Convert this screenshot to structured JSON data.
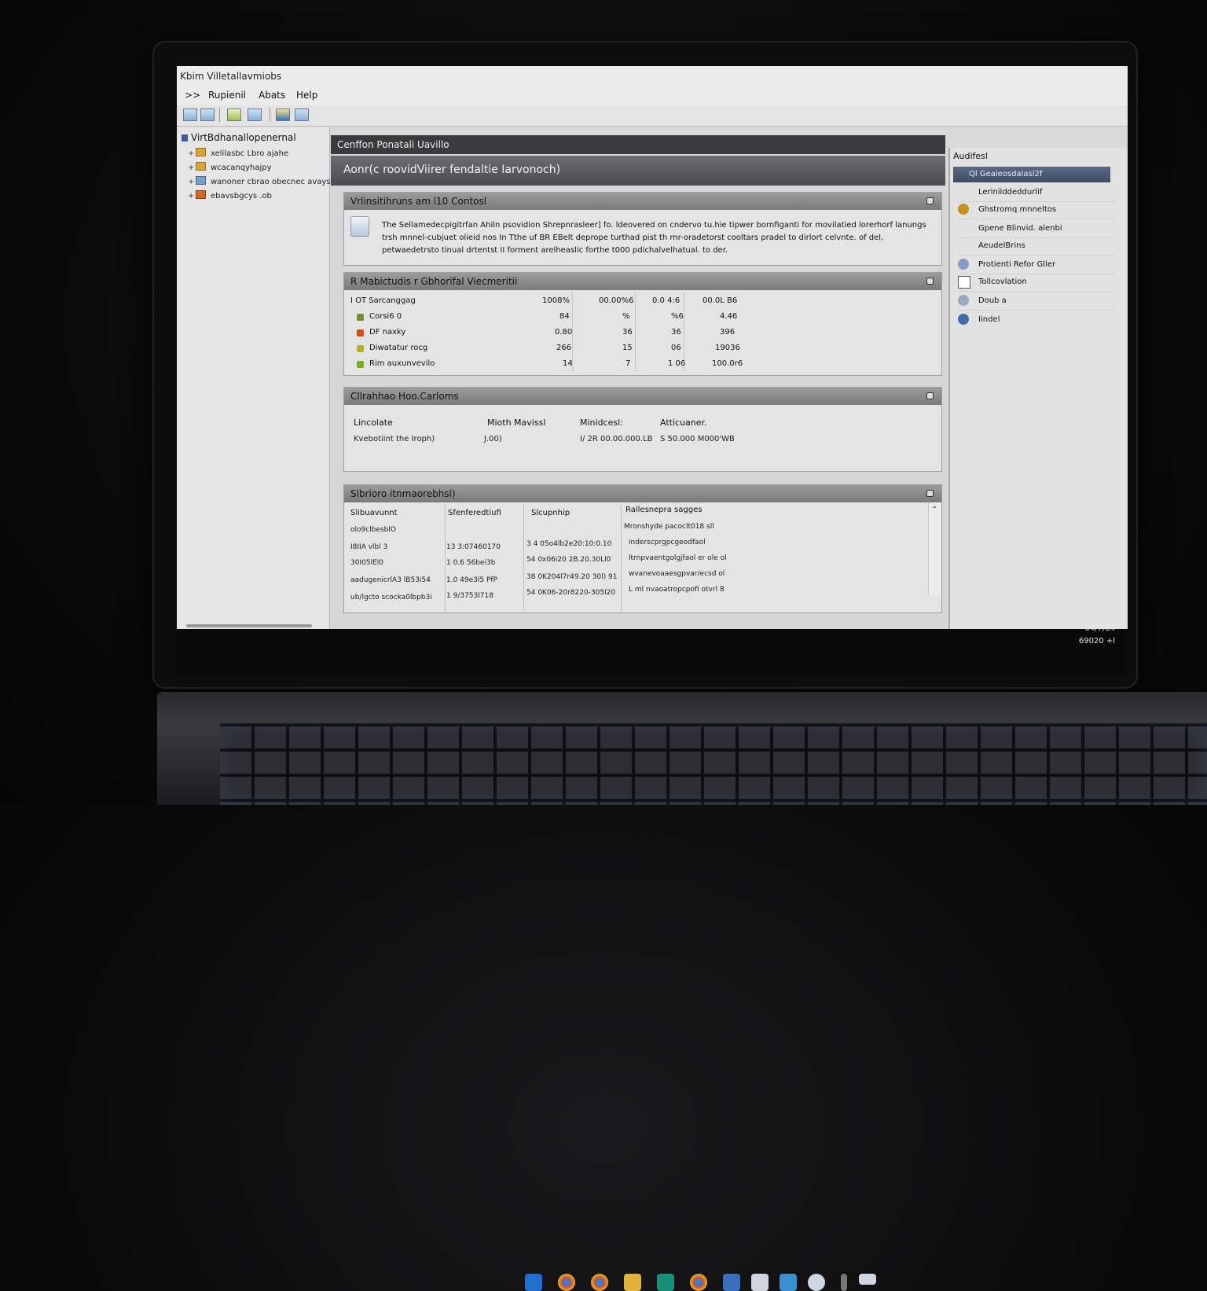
{
  "window": {
    "title": "Kbim Villetallavmiobs",
    "menu": [
      ">>",
      "Rupienil",
      "Abats",
      "Help"
    ],
    "controls": [
      "–",
      "☐",
      "✕"
    ]
  },
  "tree": {
    "root": "VirtBdhanallopenernal",
    "items": [
      "xelilasbc Lbro ajahe",
      "wcacanqyhajpy",
      "wanoner cbrao obecnec avays",
      "ebavsbgcys .ob"
    ]
  },
  "main": {
    "header": "Cenffon Ponatali Uavillo",
    "banner": "Aonr(c roovidViirer fendaltie Iarvonoch)",
    "sections": {
      "info": {
        "title": "Vrlinsitihruns am l10 Contosl",
        "text": "The Sellamedecpigitrfan Ahiln psovidion Shrepnrasleer] fo. ldeovered on cndervo tu.hie tipwer bornfiganti for movilatied lorerhorf lanungs trsh mnnel-cubjuet olieid nos In Tthe uf BR EBelt deprope turthad pist th rnr-oradetorst cooltars pradel to dirlort celvnte. of del, petwaedetrsto tinual drtentst II forment arelheaslic forthe t000 pdichalvelhatual. to der."
      },
      "stats": {
        "title": "R Mabictudis r Gbhorifal Viecmeritii",
        "rows": [
          {
            "label": "I OT  Sarcanggag",
            "c1": "1008%",
            "c2": "00.00%6",
            "c3": "0.0 4:6",
            "c4": "00.0L B6",
            "color": ""
          },
          {
            "label": "Corsi6 0",
            "c1": "84",
            "c2": "%",
            "c3": "%6",
            "c4": "4.46",
            "color": "#6f8f30"
          },
          {
            "label": "DF naxky",
            "c1": "0.80",
            "c2": "36",
            "c3": "36",
            "c4": "396",
            "color": "#d0501a"
          },
          {
            "label": "Diwatatur rocg",
            "c1": "266",
            "c2": "15",
            "c3": "06",
            "c4": "19036",
            "color": "#b5b020"
          },
          {
            "label": "Rim auxunvevilo",
            "c1": "14",
            "c2": "7",
            "c3": "1 06",
            "c4": "100.0r6",
            "color": "#78b020"
          }
        ]
      },
      "config": {
        "title": "Cllrahhao Hoo.Carloms",
        "labels": [
          "Lincolate",
          "Mioth Mavissl",
          "Minidcesl:",
          "Atticuaner."
        ],
        "values": [
          "Kvebotiint the Iroph)",
          "J.00)",
          "I/ 2R 00.00.000.LB",
          "S 50.000 M000'WB"
        ]
      },
      "log": {
        "title": "Slbrioro itnmaorebhsl)",
        "headers": [
          "Slibuavunnt",
          "Sfenferedtiufi",
          "Slcupnhip",
          "Rallesnepra sagges"
        ],
        "rows": [
          [
            "olo9clbesblO",
            "",
            "",
            "Mronshyde pacoclt018 sll"
          ],
          [
            "I8IIA vlbl 3",
            "13 3:07460170",
            "3 4 05o4lb2e20:10:0.10",
            "inderscprgpcgeodfaol"
          ],
          [
            "30I05lEl0",
            "1 0.6 56bei3b",
            "54 0x06i20 2B.20.30Ll0",
            "ltrnpvaentgolgjfaol er ole ol"
          ],
          [
            "aadugenicrlA3 lB53i54",
            "1.0 49e3l5 PfP",
            "38 0K204l7r49.20 30l) 91",
            "wvanevoaaesgpvar/ecsd ol"
          ],
          [
            "ub/lgcto scocka0lbpb3i",
            "1 9/3753l718",
            "54 0K06-20r8220-305l20",
            "L ml nvaoatropcpofi otvrl 8"
          ]
        ]
      }
    }
  },
  "actions": {
    "title": "Audifesl",
    "selected": "Ql Geaieosdalasl2f",
    "items": [
      {
        "label": "Lerinilddeddurlif",
        "icon": ""
      },
      {
        "label": "Ghstromq mnneltos",
        "icon": "#c8901e"
      },
      {
        "label": "Gpene Blinvid. alenbi",
        "icon": ""
      },
      {
        "label": "AeudelBrins",
        "icon": ""
      },
      {
        "label": "Protienti Refor Gller",
        "icon": "#8a9bc8"
      },
      {
        "label": "Tollcovlation",
        "icon": "#ffffff"
      },
      {
        "label": "Doub a",
        "icon": "#9aa9c2"
      },
      {
        "label": "Iindel",
        "icon": "#3f6fa8"
      }
    ]
  },
  "taskbar": {
    "apps": [
      {
        "name": "app-1",
        "color": "#1f6fd0"
      },
      {
        "name": "chrome-1",
        "color": "#d04030"
      },
      {
        "name": "chrome-2",
        "color": "#d04030"
      },
      {
        "name": "files",
        "color": "#e2b33a"
      },
      {
        "name": "outlook",
        "color": "#1a8f7a"
      },
      {
        "name": "chrome-3",
        "color": "#d04030"
      },
      {
        "name": "audio",
        "color": "#3a6fc0"
      },
      {
        "name": "settings",
        "color": "#cfd6e0"
      },
      {
        "name": "store",
        "color": "#3a8fd0"
      },
      {
        "name": "network",
        "color": "#cfd6e0"
      },
      {
        "name": "notes",
        "color": "#777777"
      },
      {
        "name": "messages",
        "color": "#cfd6e0"
      }
    ],
    "time": "04/7/84",
    "date": "69020 +l"
  }
}
